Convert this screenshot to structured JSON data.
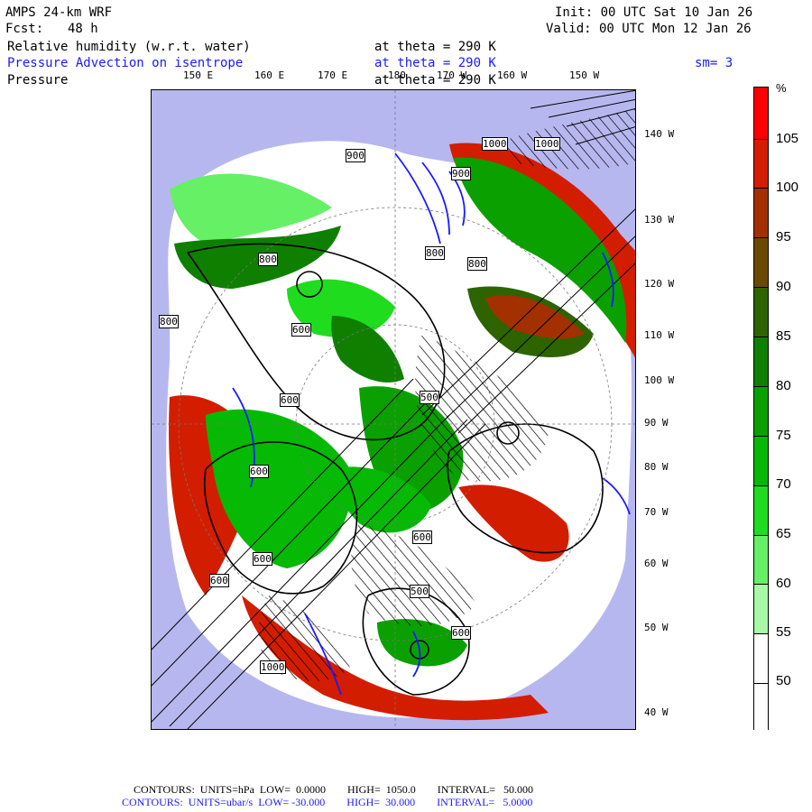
{
  "header": {
    "model": "AMPS 24-km WRF",
    "fcst_label": "Fcst:",
    "fcst_value": "48 h",
    "init": "Init: 00 UTC Sat 10 Jan 26",
    "valid": "Valid: 00 UTC Mon 12 Jan 26"
  },
  "fields": [
    {
      "name": "Relative humidity (w.r.t. water)",
      "level": "at theta = 290 K",
      "color": "#000000"
    },
    {
      "name": "Pressure Advection on isentrope",
      "level": "at theta = 290 K",
      "color": "#1a1aff"
    },
    {
      "name": "Pressure",
      "level": "at theta = 290 K",
      "color": "#000000"
    }
  ],
  "smoothing": "sm= 3",
  "top_longitudes": [
    "150 E",
    "160 E",
    "170 E",
    "180",
    "170 W",
    "160 W",
    "150 W"
  ],
  "right_longitudes": [
    "140 W",
    "130 W",
    "120 W",
    "110 W",
    "100 W",
    "90 W",
    "80 W",
    "70 W",
    "60 W",
    "50 W",
    "40 W"
  ],
  "pressure_labels": [
    "800",
    "900",
    "800",
    "600",
    "600",
    "500",
    "600",
    "600",
    "800",
    "900",
    "1000",
    "1000",
    "800",
    "600",
    "600",
    "600",
    "500",
    "1000"
  ],
  "colorbar": {
    "unit": "%",
    "levels": [
      "105",
      "100",
      "95",
      "90",
      "85",
      "80",
      "75",
      "70",
      "65",
      "60",
      "55",
      "50"
    ],
    "colors": [
      "#ff0000",
      "#d31d00",
      "#a33000",
      "#6a4a00",
      "#2d6400",
      "#0f7f00",
      "#0aa000",
      "#05b905",
      "#1fdc1f",
      "#66f066",
      "#a8f8a8",
      "#ffffff",
      "#ffffff"
    ]
  },
  "footer": {
    "line1": "CONTOURS:  UNITS=hPa  LOW=  0.0000        HIGH=  1050.0        INTERVAL=   50.000",
    "line2": "CONTOURS:  UNITS=ubar/s  LOW= -30.000        HIGH=  30.000        INTERVAL=   5.0000"
  }
}
